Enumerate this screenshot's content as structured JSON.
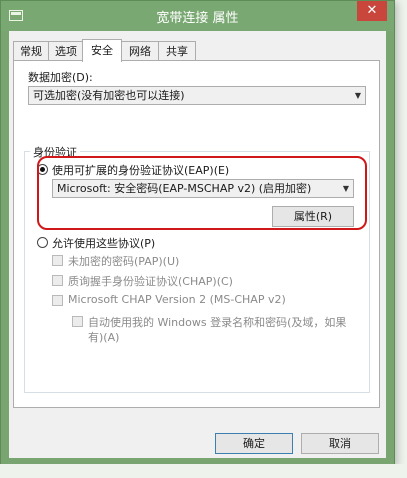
{
  "window": {
    "title": "宽带连接 属性",
    "close_glyph": "✕"
  },
  "tabs": [
    {
      "label": "常规"
    },
    {
      "label": "选项"
    },
    {
      "label": "安全"
    },
    {
      "label": "网络"
    },
    {
      "label": "共享"
    }
  ],
  "security": {
    "data_encryption_label": "数据加密(D):",
    "data_encryption_value": "可选加密(没有加密也可以连接)",
    "auth_group_title": "身份验证",
    "eap_radio_label": "使用可扩展的身份验证协议(EAP)(E)",
    "eap_method_value": "Microsoft: 安全密码(EAP-MSCHAP v2) (启用加密)",
    "properties_button": "属性(R)",
    "allow_protocols_label": "允许使用这些协议(P)",
    "protocols": [
      {
        "label": "未加密的密码(PAP)(U)"
      },
      {
        "label": "质询握手身份验证协议(CHAP)(C)"
      },
      {
        "label": "Microsoft CHAP Version 2 (MS-CHAP v2)"
      }
    ],
    "auto_logon_line1": "自动使用我的 Windows 登录名称和密码(及域，如果",
    "auto_logon_line2": "有)(A)"
  },
  "footer": {
    "ok_label": "确定",
    "cancel_label": "取消"
  },
  "colors": {
    "title_bar": "#7aa872",
    "close_button": "#c8463b",
    "highlight_ring": "#d01818"
  }
}
